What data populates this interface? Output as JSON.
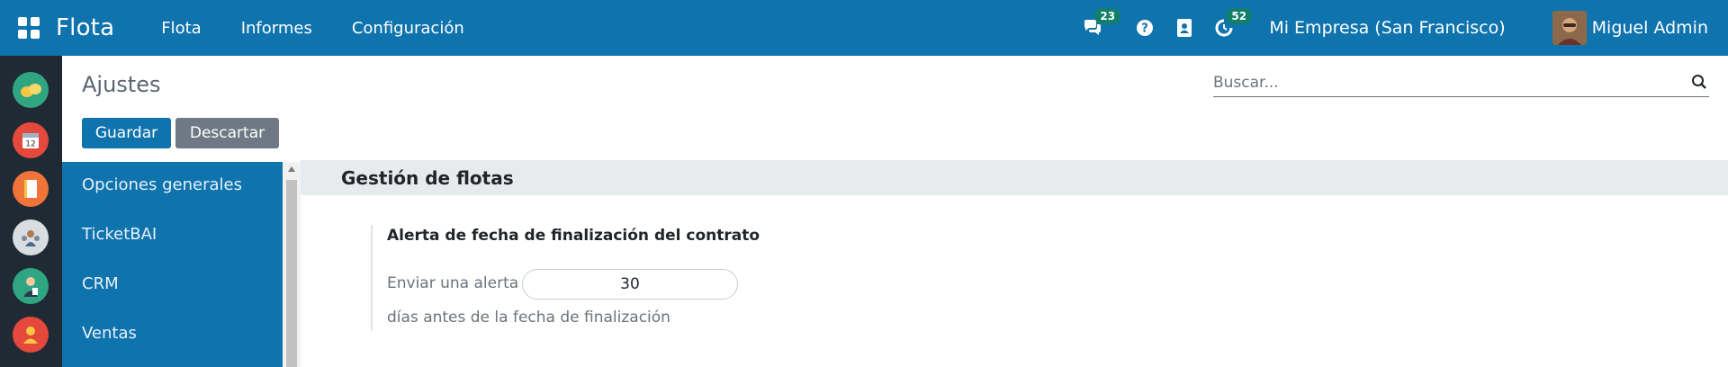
{
  "navbar": {
    "app_name": "Flota",
    "menu": [
      "Flota",
      "Informes",
      "Configuración"
    ],
    "messages_badge": "23",
    "activities_badge": "52",
    "company": "Mi Empresa (San Francisco)",
    "user": "Miguel Admin",
    "colors": {
      "bar": "#0f73ad",
      "badge": "#137f6b"
    }
  },
  "rail_apps": [
    {
      "icon": "discuss-icon",
      "color": "#2fa582"
    },
    {
      "icon": "calendar-icon",
      "color": "#e4493b"
    },
    {
      "icon": "notes-icon",
      "color": "#f0743a"
    },
    {
      "icon": "contacts-icon",
      "color": "#d8dde2"
    },
    {
      "icon": "employees-icon",
      "color": "#2fa582"
    },
    {
      "icon": "recruitment-icon",
      "color": "#e4493b"
    }
  ],
  "control_panel": {
    "title": "Ajustes",
    "search_placeholder": "Buscar...",
    "save_label": "Guardar",
    "discard_label": "Descartar"
  },
  "settings_nav": {
    "items": [
      "Opciones generales",
      "TicketBAI",
      "CRM",
      "Ventas"
    ]
  },
  "section": {
    "title": "Gestión de flotas",
    "setting": {
      "title": "Alerta de fecha de finalización del contrato",
      "label_before": "Enviar una alerta",
      "value": "30",
      "label_after": "días antes de la fecha de finalización"
    }
  }
}
